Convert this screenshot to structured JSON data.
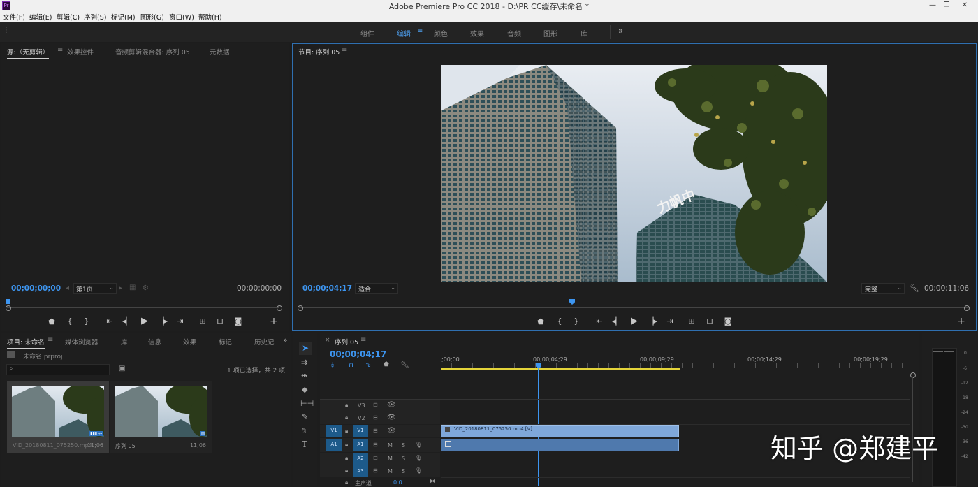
{
  "window": {
    "title": "Adobe Premiere Pro CC 2018 - D:\\PR CC缓存\\未命名 *",
    "app_icon": "Pr",
    "min": "—",
    "max": "❐",
    "close": "✕"
  },
  "menu": [
    "文件(F)",
    "编辑(E)",
    "剪辑(C)",
    "序列(S)",
    "标记(M)",
    "图形(G)",
    "窗口(W)",
    "帮助(H)"
  ],
  "workspaces": [
    "组件",
    "编辑",
    "颜色",
    "效果",
    "音频",
    "图形",
    "库"
  ],
  "workspace_more": "»",
  "source_panel": {
    "tabs": [
      "源:（无剪辑）",
      "效果控件",
      "音频剪辑混合器: 序列 05",
      "元数据"
    ],
    "timecode_in": "00;00;00;00",
    "timecode_out": "00;00;00;00",
    "page_select": "第1页"
  },
  "program_panel": {
    "tab": "节目: 序列 05",
    "timecode_in": "00;00;04;17",
    "fit_select": "适合",
    "quality_select": "完整",
    "timecode_out": "00;00;11;06",
    "video_sign": "力帆中"
  },
  "project_panel": {
    "tabs": [
      "项目: 未命名",
      "媒体浏览器",
      "库",
      "信息",
      "效果",
      "标记",
      "历史记"
    ],
    "more": "»",
    "file": "未命名.prproj",
    "selection": "1 项已选择，共 2 项",
    "search_placeholder": "",
    "items": [
      {
        "name": "VID_20180811_075250.mp4",
        "duration": "11;06"
      },
      {
        "name": "序列 05",
        "duration": "11;06"
      }
    ]
  },
  "timeline": {
    "tab": "序列 05",
    "close": "×",
    "timecode": "00;00;04;17",
    "ruler_labels": [
      ";00;00",
      "00;00;04;29",
      "00;00;09;29",
      "00;00;14;29",
      "00;00;19;29"
    ],
    "tracks": [
      {
        "src": "",
        "name": "V3"
      },
      {
        "src": "",
        "name": "V2"
      },
      {
        "src": "V1",
        "name": "V1"
      },
      {
        "src": "A1",
        "name": "A1"
      },
      {
        "src": "",
        "name": "A2"
      },
      {
        "src": "",
        "name": "A3"
      }
    ],
    "master": "主声道",
    "master_value": "0.0",
    "clip_label": "VID_20180811_075250.mp4 [V]",
    "m": "M",
    "s": "S"
  },
  "meter_labels": [
    "0",
    "-6",
    "-12",
    "-18",
    "-24",
    "-30",
    "-36",
    "-42"
  ],
  "watermark": "知乎 @郑建平",
  "colors": {
    "accent": "#3d95f0",
    "clip": "#7fa7d9",
    "work_area": "#e4d43a"
  }
}
